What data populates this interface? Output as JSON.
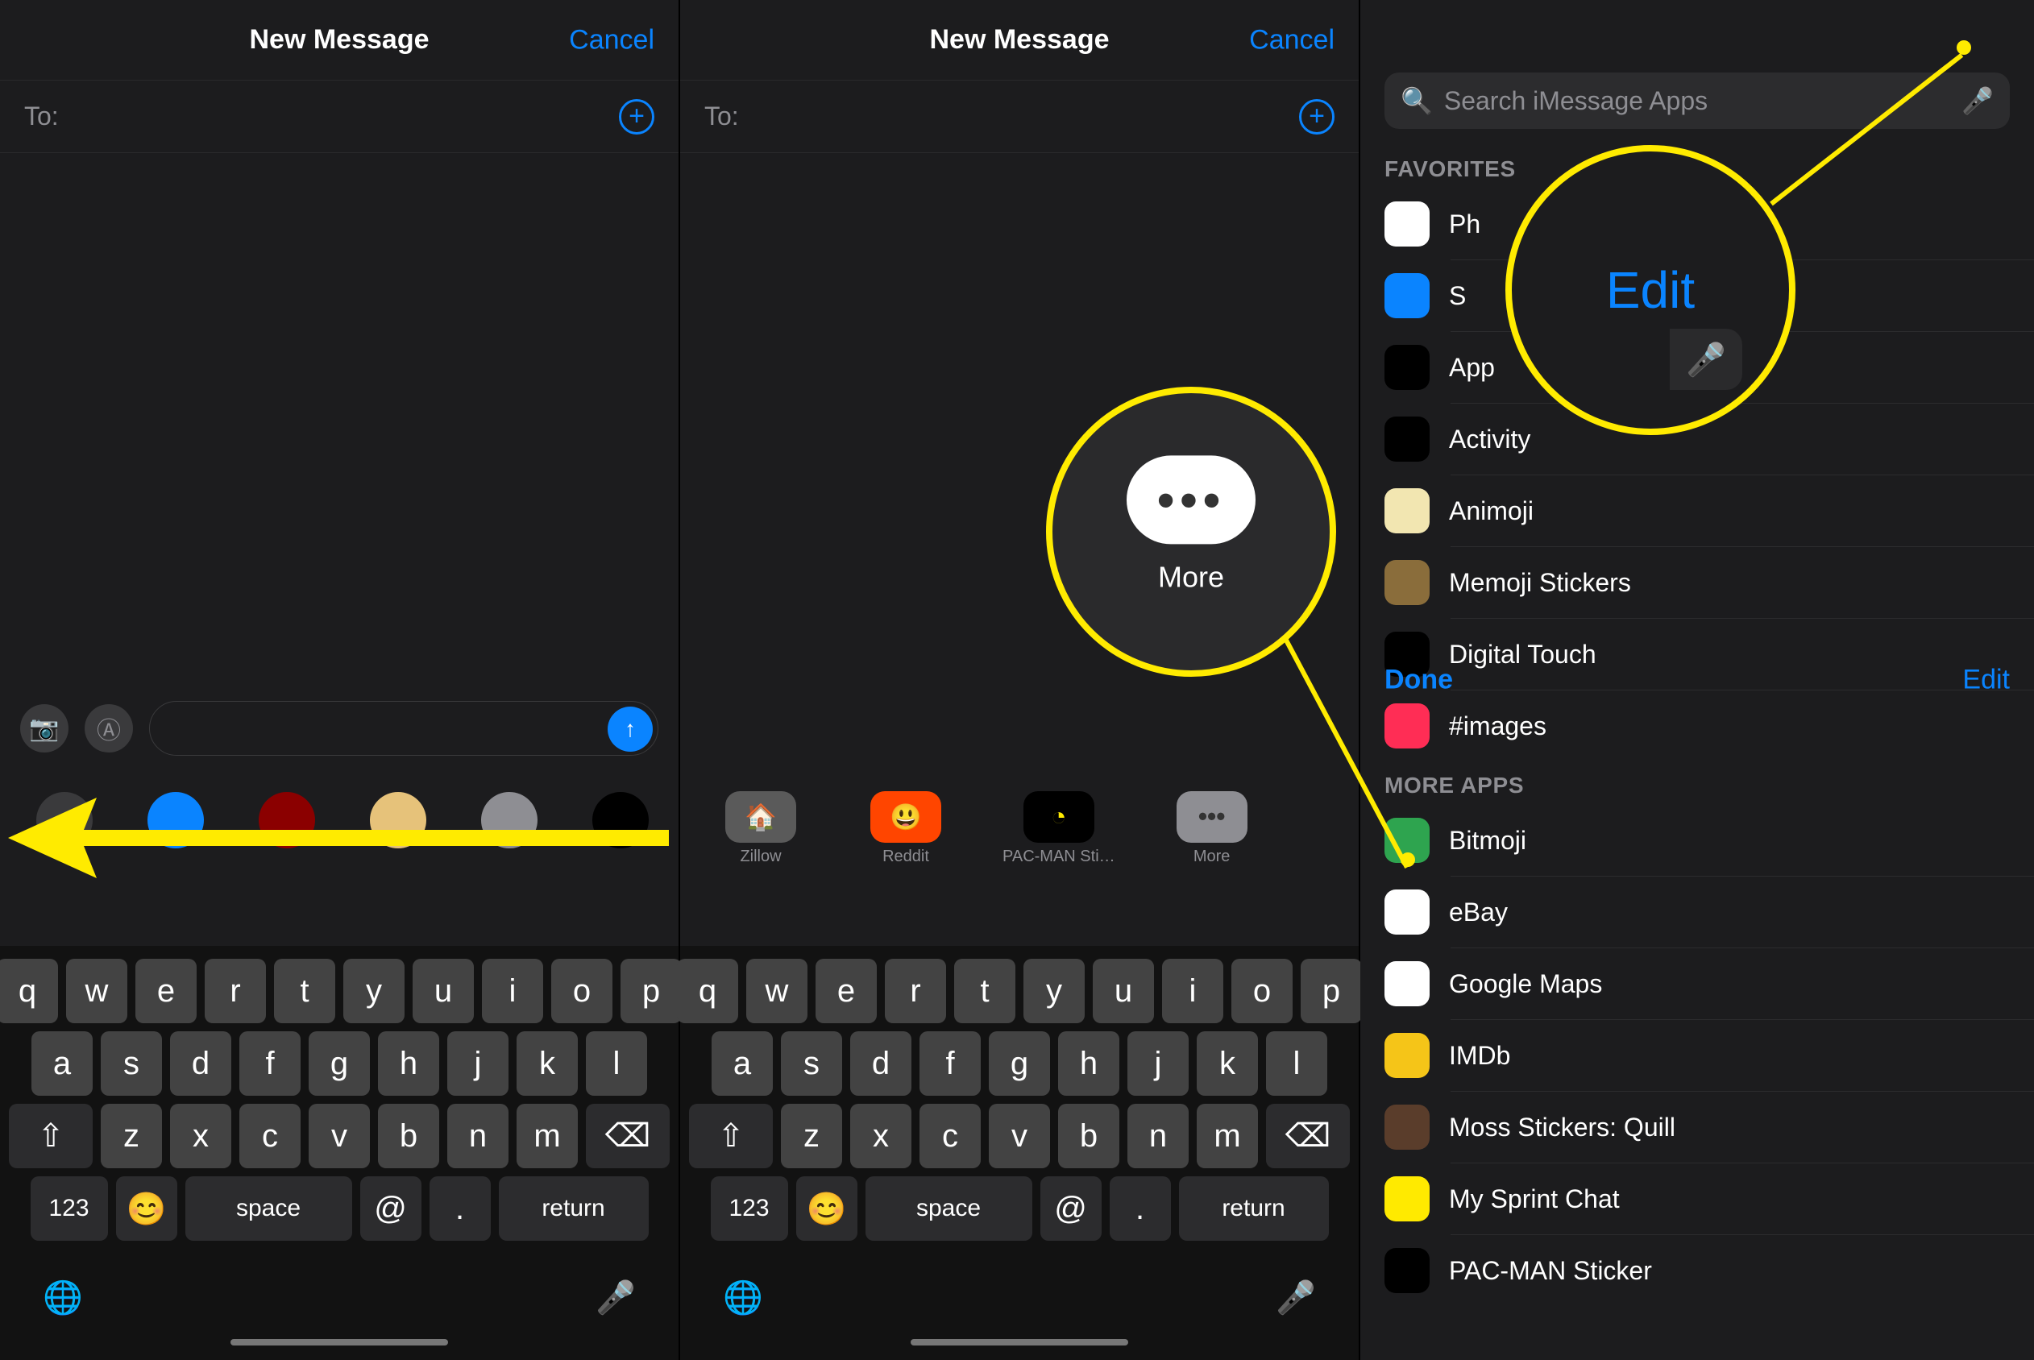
{
  "panel1": {
    "title": "New Message",
    "cancel": "Cancel",
    "to_label": "To:",
    "apps": [
      "",
      "",
      "",
      "",
      "",
      "",
      ""
    ],
    "keyboard": {
      "row1": [
        "q",
        "w",
        "e",
        "r",
        "t",
        "y",
        "u",
        "i",
        "o",
        "p"
      ],
      "row2": [
        "a",
        "s",
        "d",
        "f",
        "g",
        "h",
        "j",
        "k",
        "l"
      ],
      "row3": [
        "⇧",
        "z",
        "x",
        "c",
        "v",
        "b",
        "n",
        "m",
        "⌫"
      ],
      "row4": [
        "123",
        "😊",
        "space",
        "@",
        ".",
        "return"
      ]
    }
  },
  "panel2": {
    "title": "New Message",
    "cancel": "Cancel",
    "to_label": "To:",
    "magnified_label": "More",
    "apps": [
      {
        "label": "Zillow",
        "bg": "#5a5a5a"
      },
      {
        "label": "Reddit",
        "bg": "#ff4500"
      },
      {
        "label": "PAC-MAN Sti…",
        "bg": "#000"
      },
      {
        "label": "More",
        "bg": "#8e8e93"
      }
    ],
    "keyboard": {
      "row1": [
        "q",
        "w",
        "e",
        "r",
        "t",
        "y",
        "u",
        "i",
        "o",
        "p"
      ],
      "row2": [
        "a",
        "s",
        "d",
        "f",
        "g",
        "h",
        "j",
        "k",
        "l"
      ],
      "row3": [
        "⇧",
        "z",
        "x",
        "c",
        "v",
        "b",
        "n",
        "m",
        "⌫"
      ],
      "row4": [
        "123",
        "😊",
        "space",
        "@",
        ".",
        "return"
      ]
    }
  },
  "panel3": {
    "done": "Done",
    "edit": "Edit",
    "search_placeholder": "Search iMessage Apps",
    "magnified_text": "Edit",
    "favorites_header": "FAVORITES",
    "favorites": [
      {
        "label": "Photos",
        "trunc": "Ph",
        "bg": "#fff"
      },
      {
        "label": "Store",
        "trunc": "S",
        "bg": "#0a84ff"
      },
      {
        "label": "Apple Pay",
        "trunc": "App",
        "bg": "#000"
      },
      {
        "label": "Activity",
        "bg": "#000"
      },
      {
        "label": "Animoji",
        "bg": "#f2e6b1"
      },
      {
        "label": "Memoji Stickers",
        "bg": "#8a6d3b"
      },
      {
        "label": "Digital Touch",
        "bg": "#000"
      },
      {
        "label": "#images",
        "bg": "#ff2d55"
      }
    ],
    "more_header": "MORE APPS",
    "more_apps": [
      {
        "label": "Bitmoji",
        "bg": "#2ea44f"
      },
      {
        "label": "eBay",
        "bg": "#fff"
      },
      {
        "label": "Google Maps",
        "bg": "#fff"
      },
      {
        "label": "IMDb",
        "bg": "#f5c518"
      },
      {
        "label": "Moss Stickers: Quill",
        "bg": "#5a3d2b"
      },
      {
        "label": "My Sprint Chat",
        "bg": "#ffea00"
      },
      {
        "label": "PAC-MAN Sticker",
        "bg": "#000"
      }
    ]
  },
  "colors": {
    "accent": "#0a84ff",
    "annotation": "#ffeb00"
  }
}
